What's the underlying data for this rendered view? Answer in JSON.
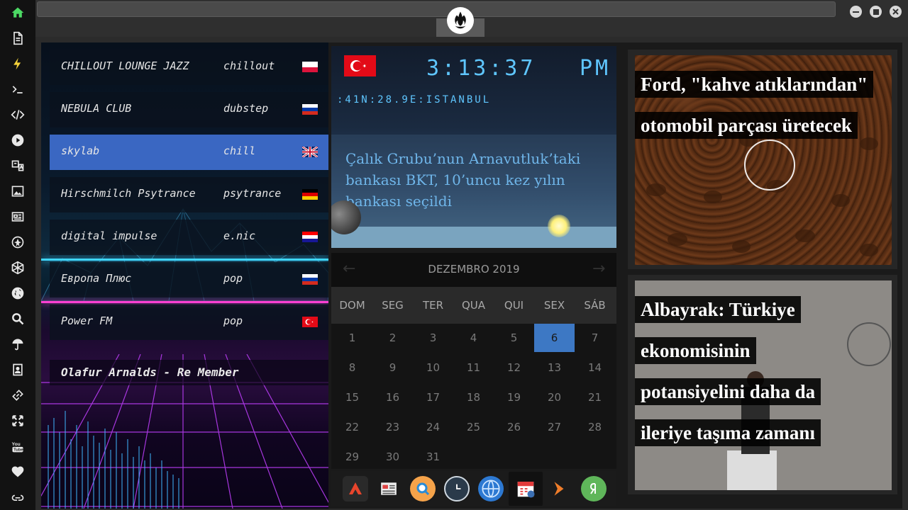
{
  "radio": {
    "stations": [
      {
        "name": "CHILLOUT LOUNGE JAZZ",
        "genre": "chillout",
        "flag": "poland"
      },
      {
        "name": "NEBULA CLUB",
        "genre": "dubstep",
        "flag": "russia"
      },
      {
        "name": "skylab",
        "genre": "chill",
        "flag": "uk"
      },
      {
        "name": "Hirschmilch Psytrance",
        "genre": "psytrance",
        "flag": "germany"
      },
      {
        "name": "digital impulse",
        "genre": "e.nic",
        "flag": "croatia"
      },
      {
        "name": "Европа Плюс",
        "genre": "pop",
        "flag": "russia"
      },
      {
        "name": "Power FM",
        "genre": "pop",
        "flag": "turkey"
      }
    ],
    "now_playing": "Olafur Arnalds - Re Member"
  },
  "clock": {
    "time": "3:13:37",
    "ampm": "PM",
    "location": ":41N:28.9E:ISTANBUL",
    "headline": "Çalık Grubu’nun Arnavutluk’taki bankası BKT, 10’uncu kez yılın bankası seçildi"
  },
  "calendar": {
    "month": "DEZEMBRO 2019",
    "weekdays": [
      "DOM",
      "SEG",
      "TER",
      "QUA",
      "QUI",
      "SEX",
      "SÁB"
    ],
    "days": [
      "1",
      "2",
      "3",
      "4",
      "5",
      "6",
      "7",
      "8",
      "9",
      "10",
      "11",
      "12",
      "13",
      "14",
      "15",
      "16",
      "17",
      "18",
      "19",
      "20",
      "21",
      "22",
      "23",
      "24",
      "25",
      "26",
      "27",
      "28",
      "29",
      "30",
      "31"
    ],
    "today": "6"
  },
  "news": [
    {
      "title": "Ford, \"kahve atıklarından\" otomobil parçası üretecek"
    },
    {
      "title": "Albayrak: Türkiye ekonomisinin potansiyelini daha da ileriye taşıma zamanı"
    }
  ],
  "dock": {
    "apps": [
      "arrow-app-icon",
      "news-app-icon",
      "search-app-icon",
      "clock-app-icon",
      "globe-app-icon",
      "calendar-app-icon",
      "forward-app-icon",
      "yandex-app-icon"
    ]
  },
  "colors": {
    "accent": "#3d78c4",
    "clock_text": "#5fc6ff",
    "headline_text": "#6fb6ea"
  }
}
